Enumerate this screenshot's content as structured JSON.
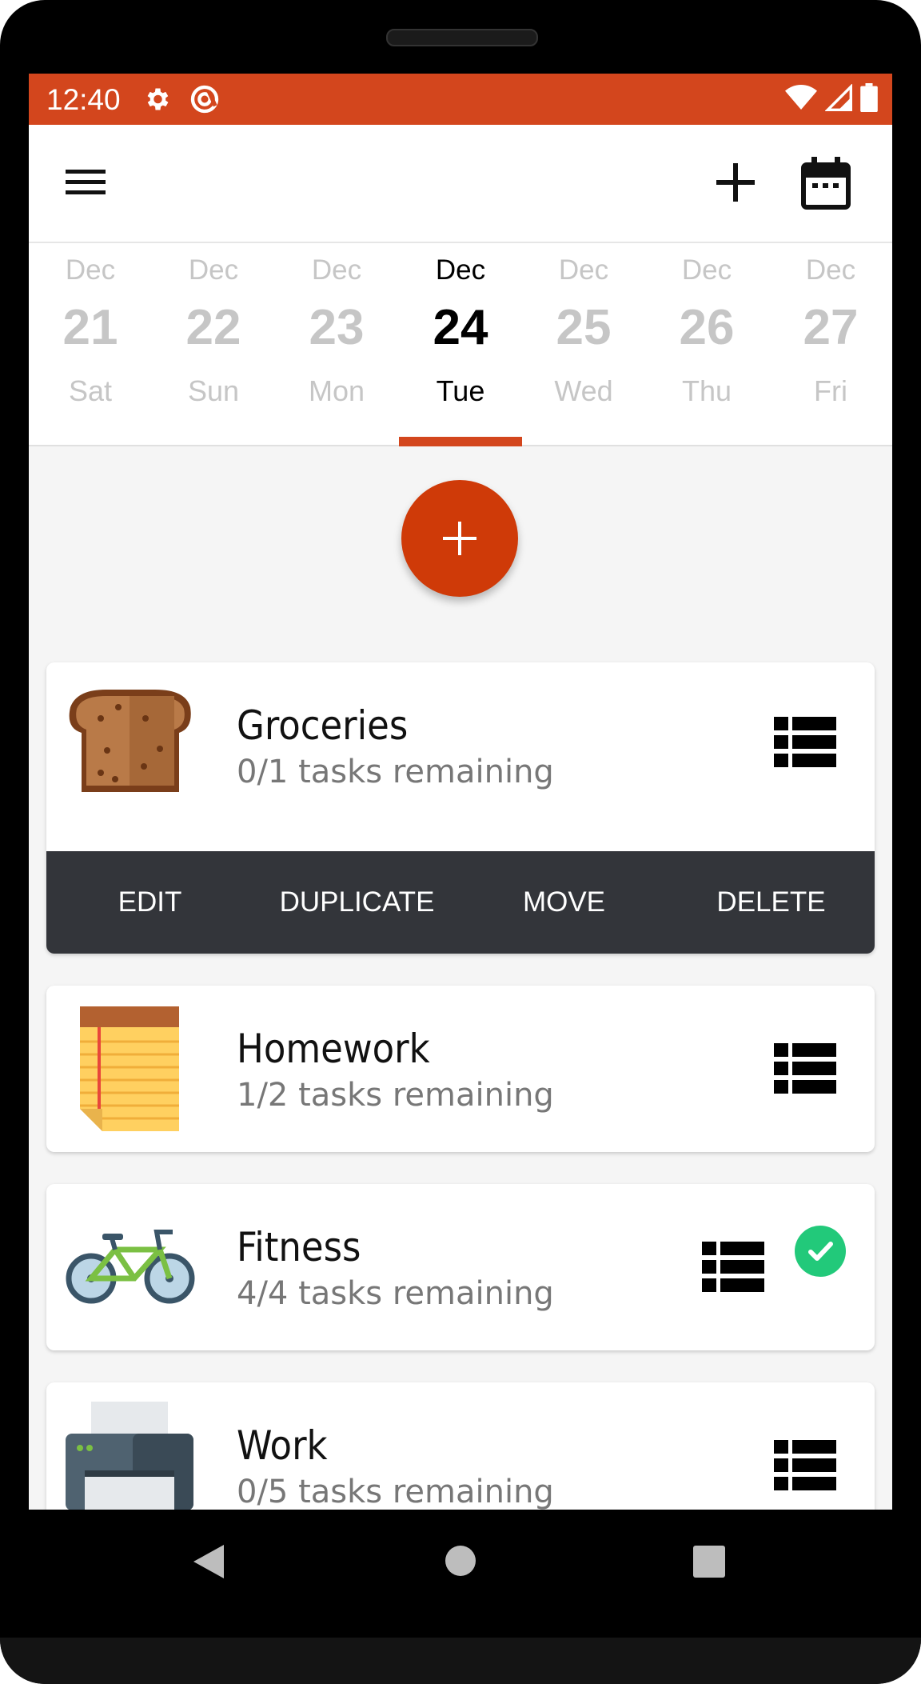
{
  "status_bar": {
    "time": "12:40",
    "color": "#d3461d"
  },
  "app_bar": {
    "menu_icon": "hamburger-menu-icon",
    "add_icon": "plus-icon",
    "calendar_icon": "calendar-icon"
  },
  "date_strip": {
    "days": [
      {
        "month": "Dec",
        "day": "21",
        "weekday": "Sat"
      },
      {
        "month": "Dec",
        "day": "22",
        "weekday": "Sun"
      },
      {
        "month": "Dec",
        "day": "23",
        "weekday": "Mon"
      },
      {
        "month": "Dec",
        "day": "24",
        "weekday": "Tue"
      },
      {
        "month": "Dec",
        "day": "25",
        "weekday": "Wed"
      },
      {
        "month": "Dec",
        "day": "26",
        "weekday": "Thu"
      },
      {
        "month": "Dec",
        "day": "27",
        "weekday": "Fri"
      }
    ],
    "selected_index": 3,
    "accent": "#d3461d"
  },
  "fab": {
    "icon": "plus-icon",
    "color": "#cf3a08"
  },
  "lists": [
    {
      "title": "Groceries",
      "subtitle": "0/1 tasks remaining",
      "icon": "toast-bread-icon",
      "completed": false
    },
    {
      "title": "Homework",
      "subtitle": "1/2 tasks remaining",
      "icon": "notepad-icon",
      "completed": false
    },
    {
      "title": "Fitness",
      "subtitle": "4/4 tasks remaining",
      "icon": "bicycle-icon",
      "completed": true
    },
    {
      "title": "Work",
      "subtitle": "0/5 tasks remaining",
      "icon": "printer-icon",
      "completed": false
    }
  ],
  "actions": {
    "edit": "EDIT",
    "duplicate": "DUPLICATE",
    "move": "MOVE",
    "delete": "DELETE"
  }
}
